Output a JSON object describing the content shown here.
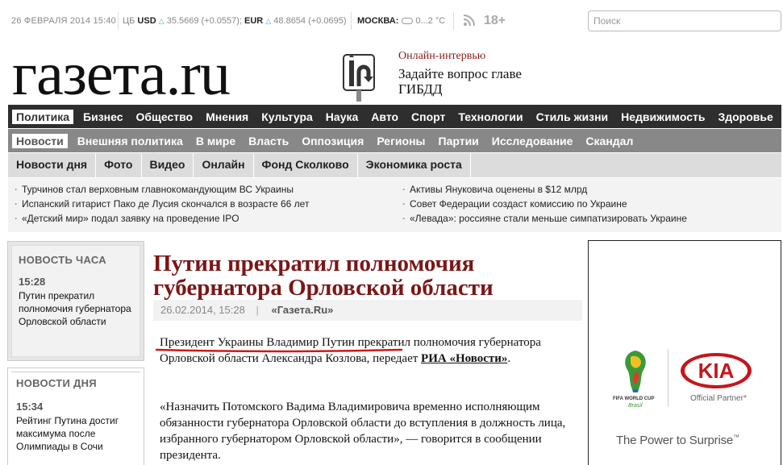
{
  "topbar": {
    "date": "26 ФЕВРАЛЯ 2014 15:40",
    "cb_label": "ЦБ",
    "usd_label": "USD",
    "usd_rate": "35.5669 (+0.0557);",
    "eur_label": "EUR",
    "eur_rate": "48.8654 (+0.0695)",
    "city_label": "МОСКВА:",
    "temperature": "0...2 °С",
    "age_rating": "18+",
    "search_placeholder": "Поиск",
    "up_glyph": "△"
  },
  "header": {
    "logo": "газета.ru",
    "promo_kicker": "Онлайн-интервью",
    "promo_text": "Задайте вопрос главе ГИБДД"
  },
  "nav_main": [
    {
      "label": "Политика",
      "active": true
    },
    {
      "label": "Бизнес"
    },
    {
      "label": "Общество"
    },
    {
      "label": "Мнения"
    },
    {
      "label": "Культура"
    },
    {
      "label": "Наука"
    },
    {
      "label": "Авто"
    },
    {
      "label": "Спорт"
    },
    {
      "label": "Технологии"
    },
    {
      "label": "Стиль жизни"
    },
    {
      "label": "Недвижимость"
    },
    {
      "label": "Здоровье"
    }
  ],
  "nav_sub": [
    {
      "label": "Новости",
      "active": true
    },
    {
      "label": "Внешняя политика"
    },
    {
      "label": "В мире"
    },
    {
      "label": "Власть"
    },
    {
      "label": "Оппозиция"
    },
    {
      "label": "Регионы"
    },
    {
      "label": "Партии"
    },
    {
      "label": "Исследование"
    },
    {
      "label": "Скандал"
    }
  ],
  "nav_sections": [
    {
      "label": "Новости дня"
    },
    {
      "label": "Фото"
    },
    {
      "label": "Видео"
    },
    {
      "label": "Онлайн"
    },
    {
      "label": "Фонд Сколково"
    },
    {
      "label": "Экономика роста"
    }
  ],
  "ticker": {
    "left": [
      "Турчинов стал верховным главнокомандующим ВС Украины",
      "Испанский гитарист Пако де Лусия скончался в возрасте 66 лет",
      "«Детский мир» подал заявку на проведение IPO"
    ],
    "right": [
      "Активы Януковича оценены в $12 млрд",
      "Совет Федерации создаст комиссию по Украине",
      "«Левада»: россияне стали меньше симпатизировать Украине"
    ]
  },
  "news_hour": {
    "heading": "НОВОСТЬ ЧАСА",
    "time": "15:28",
    "text": "Путин прекратил полномочия губернатора Орловской области"
  },
  "news_day": {
    "heading": "НОВОСТИ ДНЯ",
    "time": "15:34",
    "text": "Рейтинг Путина достиг максимума после Олимпиады в Сочи"
  },
  "article": {
    "title": "Путин прекратил полномочия губернатора Орловской области",
    "date": "26.02.2014, 15:28",
    "source": "«Газета.Ru»",
    "pipe": "|",
    "p1_highlight": "Президент Украины Владимир Путин",
    "p1_rest": " прекратил полномочия губернатора Орловской области Александра Козлова, передает ",
    "p1_link": "РИА «Новости»",
    "p1_end": ".",
    "p2": "«Назначить Потомского Вадима Владимировича временно исполняющим обязанности губернатора Орловской области до вступления в должность лица, избранного губернатором Орловской области», — говорится в сообщении президента."
  },
  "ad": {
    "cup_text": "FIFA WORLD CUP",
    "cup_country": "Brasil",
    "brand": "KIA",
    "partner": "Official Partner",
    "tagline": "The Power to Surprise",
    "tm": "™"
  },
  "colors": {
    "accent_red": "#7b1616",
    "nav_dark": "#2e2e2e",
    "nav_mid": "#888888",
    "kia_red": "#c4161c"
  }
}
